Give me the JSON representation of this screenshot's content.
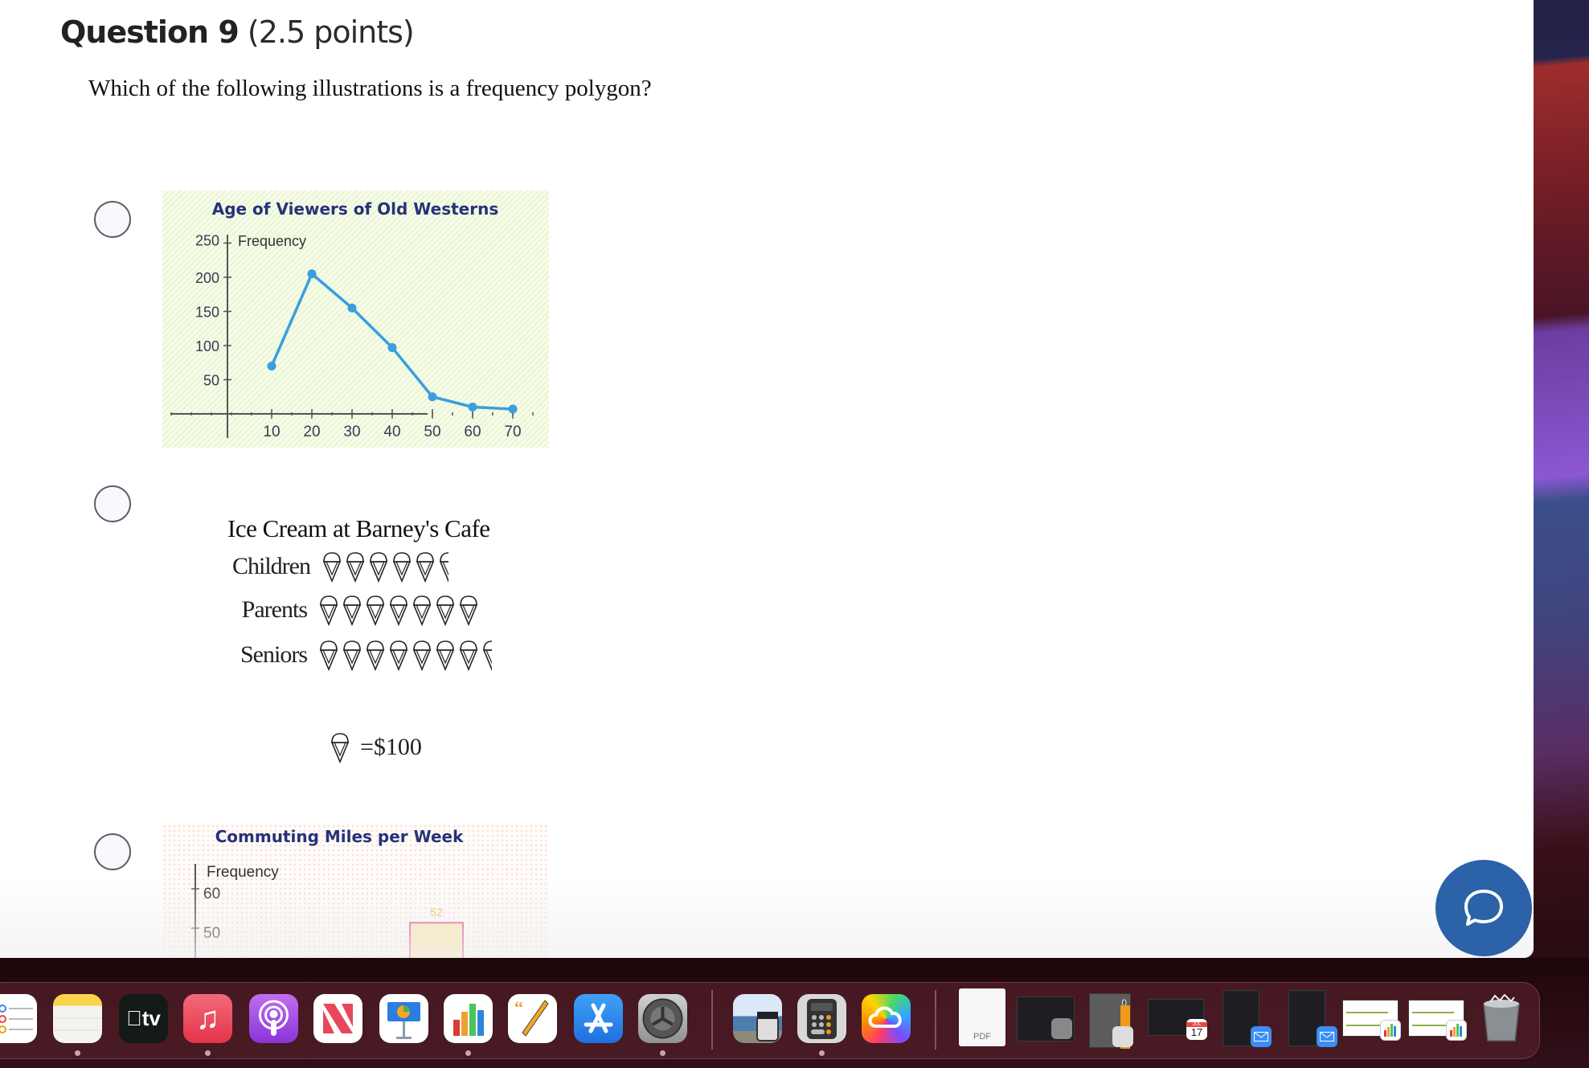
{
  "question": {
    "number_label": "Question 9",
    "points_label": "(2.5 points)",
    "prompt": "Which of the following illustrations is a frequency polygon?"
  },
  "options": [
    {
      "id": "option-1",
      "selected": false
    },
    {
      "id": "option-2",
      "selected": false
    },
    {
      "id": "option-3",
      "selected": false
    }
  ],
  "chart_data": [
    {
      "type": "line",
      "title": "Age of Viewers of Old Westerns",
      "ylabel": "Frequency",
      "xlabel": "",
      "x": [
        10,
        20,
        30,
        40,
        50,
        60,
        70
      ],
      "values": [
        70,
        205,
        155,
        97,
        25,
        10,
        7
      ],
      "xticks": [
        "10",
        "20",
        "30",
        "40",
        "50",
        "60",
        "70"
      ],
      "yticks": [
        "50",
        "100",
        "150",
        "200",
        "250"
      ],
      "ylim": [
        0,
        250
      ],
      "xlim": [
        -15,
        75
      ],
      "colors": {
        "title": "#27327a",
        "line": "#3a9ee0",
        "axis": "#555555"
      }
    },
    {
      "type": "table",
      "subtype": "pictograph",
      "title": "Ice Cream at Barney's Cafe",
      "categories": [
        "Children",
        "Parents",
        "Seniors"
      ],
      "values": [
        5.5,
        7,
        7.5
      ],
      "unit_value": 100,
      "key_label": "=$100"
    },
    {
      "type": "bar",
      "title": "Commuting Miles per Week",
      "ylabel": "Frequency",
      "yticks": [
        "60",
        "50"
      ],
      "visible_bar_labels": [
        "52"
      ],
      "values": [
        52
      ],
      "ylim": [
        45,
        65
      ],
      "colors": {
        "title": "#27327a",
        "bar_border": "#e04fa0",
        "bar_fill": "#fbe7b0",
        "bar_label": "#f2b54a"
      }
    }
  ],
  "chat": {
    "icon": "chat-bubble-icon",
    "color": "#2b62a8"
  },
  "dock": {
    "apps": [
      {
        "name": "Reminders",
        "icon": "reminders-icon"
      },
      {
        "name": "Notes",
        "icon": "notes-icon",
        "running": true
      },
      {
        "name": "TV",
        "icon": "apple-tv-icon",
        "label": "tv"
      },
      {
        "name": "Music",
        "icon": "music-icon",
        "running": true
      },
      {
        "name": "Podcasts",
        "icon": "podcasts-icon"
      },
      {
        "name": "News",
        "icon": "news-icon"
      },
      {
        "name": "Keynote",
        "icon": "keynote-icon"
      },
      {
        "name": "Numbers",
        "icon": "numbers-icon",
        "running": true
      },
      {
        "name": "Pages",
        "icon": "pages-icon"
      },
      {
        "name": "App Store",
        "icon": "app-store-icon"
      },
      {
        "name": "System Preferences",
        "icon": "system-preferences-icon",
        "running": true
      },
      {
        "name": "Preview",
        "icon": "preview-icon"
      },
      {
        "name": "Calculator",
        "icon": "calculator-icon",
        "running": true
      },
      {
        "name": "Creative Cloud",
        "icon": "creative-cloud-icon"
      }
    ],
    "minimized": [
      {
        "name": "PDF document",
        "icon": "pdf-document-icon",
        "label": "PDF"
      },
      {
        "name": "System Preferences window",
        "icon": "system-preferences-window-icon"
      },
      {
        "name": "Calculator window",
        "icon": "calculator-window-icon",
        "display": "0"
      },
      {
        "name": "Calendar window",
        "icon": "calendar-window-icon",
        "month": "JUL",
        "day": "17"
      },
      {
        "name": "Mail window 1",
        "icon": "mail-window-icon"
      },
      {
        "name": "Mail window 2",
        "icon": "mail-window-icon"
      },
      {
        "name": "Numbers window 1",
        "icon": "numbers-window-icon"
      },
      {
        "name": "Numbers window 2",
        "icon": "numbers-window-icon"
      }
    ],
    "trash": {
      "name": "Trash",
      "icon": "trash-full-icon"
    }
  }
}
